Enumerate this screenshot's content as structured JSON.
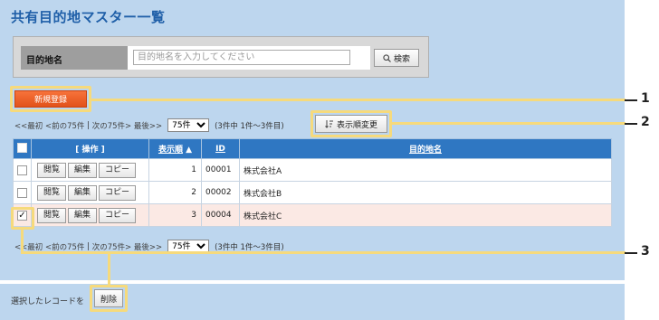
{
  "title": "共有目的地マスター一覧",
  "search": {
    "label": "目的地名",
    "placeholder": "目的地名を入力してください",
    "button": "検索"
  },
  "new_button": "新規登録",
  "pager_top": {
    "first": "<<最初",
    "prev": "<前の75件",
    "sep": "|",
    "next": "次の75件>",
    "last": "最後>>",
    "per_page": "75件",
    "range": "(3件中 1件〜3件目)"
  },
  "sort_button": "表示順変更",
  "table": {
    "headers": {
      "action": "[ 操作 ]",
      "order": "表示順",
      "order_arrow": "▲",
      "id": "ID",
      "name": "目的地名"
    },
    "row_buttons": {
      "view": "閲覧",
      "edit": "編集",
      "copy": "コピー"
    },
    "rows": [
      {
        "order": "1",
        "id": "00001",
        "name": "株式会社A",
        "checked": false
      },
      {
        "order": "2",
        "id": "00002",
        "name": "株式会社B",
        "checked": false
      },
      {
        "order": "3",
        "id": "00004",
        "name": "株式会社C",
        "checked": true
      }
    ]
  },
  "pager_bottom": {
    "first": "<<最初",
    "prev": "<前の75件",
    "sep": "|",
    "next": "次の75件>",
    "last": "最後>>",
    "per_page": "75件",
    "range": "(3件中 1件〜3件目)"
  },
  "footer": {
    "selected_text": "選択したレコードを",
    "delete_button": "削除"
  },
  "callouts": {
    "c1": "1",
    "c2": "2",
    "c3": "3"
  },
  "colors": {
    "accent": "#2f77c2",
    "panel": "#bdd6ee",
    "new_button": "#f06a30",
    "highlight": "#f6da7c"
  }
}
